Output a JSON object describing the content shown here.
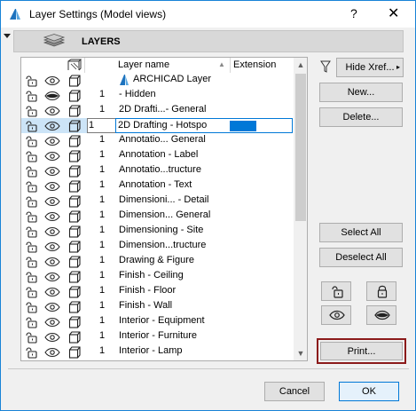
{
  "window": {
    "title": "Layer Settings (Model views)",
    "help_glyph": "?",
    "close_glyph": "✕"
  },
  "header": {
    "label": "LAYERS"
  },
  "table": {
    "columns": {
      "name": "Layer name",
      "extension": "Extension"
    },
    "sort_glyph": "▲",
    "rows": [
      {
        "number": "",
        "name": "ARCHICAD Layer",
        "archicad": true,
        "eye": "open"
      },
      {
        "number": "1",
        "name": "- Hidden",
        "eye": "closed"
      },
      {
        "number": "1",
        "name": "2D Drafti...- General",
        "eye": "open"
      },
      {
        "number": "1",
        "name": "2D Drafting - Hotspo",
        "eye": "open",
        "selected": true
      },
      {
        "number": "1",
        "name": "Annotatio... General",
        "eye": "open"
      },
      {
        "number": "1",
        "name": "Annotation - Label",
        "eye": "open"
      },
      {
        "number": "1",
        "name": "Annotatio...tructure",
        "eye": "open"
      },
      {
        "number": "1",
        "name": "Annotation - Text",
        "eye": "open"
      },
      {
        "number": "1",
        "name": "Dimensioni... - Detail",
        "eye": "open"
      },
      {
        "number": "1",
        "name": "Dimension... General",
        "eye": "open"
      },
      {
        "number": "1",
        "name": "Dimensioning - Site",
        "eye": "open"
      },
      {
        "number": "1",
        "name": "Dimension...tructure",
        "eye": "open"
      },
      {
        "number": "1",
        "name": "Drawing & Figure",
        "eye": "open"
      },
      {
        "number": "1",
        "name": "Finish - Ceiling",
        "eye": "open"
      },
      {
        "number": "1",
        "name": "Finish - Floor",
        "eye": "open"
      },
      {
        "number": "1",
        "name": "Finish - Wall",
        "eye": "open"
      },
      {
        "number": "1",
        "name": "Interior - Equipment",
        "eye": "open"
      },
      {
        "number": "1",
        "name": "Interior - Furniture",
        "eye": "open"
      },
      {
        "number": "1",
        "name": "Interior - Lamp",
        "eye": "open"
      }
    ]
  },
  "buttons": {
    "hide_xref": "Hide Xref...",
    "new": "New...",
    "delete": "Delete...",
    "select_all": "Select All",
    "deselect_all": "Deselect All",
    "print": "Print...",
    "cancel": "Cancel",
    "ok": "OK"
  },
  "icons": [
    "app-icon",
    "layers-icon",
    "lock-open-icon",
    "lock-closed-icon",
    "eye-open-icon",
    "eye-closed-icon",
    "wireframe-icon",
    "filter-icon",
    "sort-ascending-icon"
  ],
  "colors": {
    "accent": "#0078d7",
    "selected_row": "#cce4f7",
    "highlight_border": "#8b1a1a"
  }
}
